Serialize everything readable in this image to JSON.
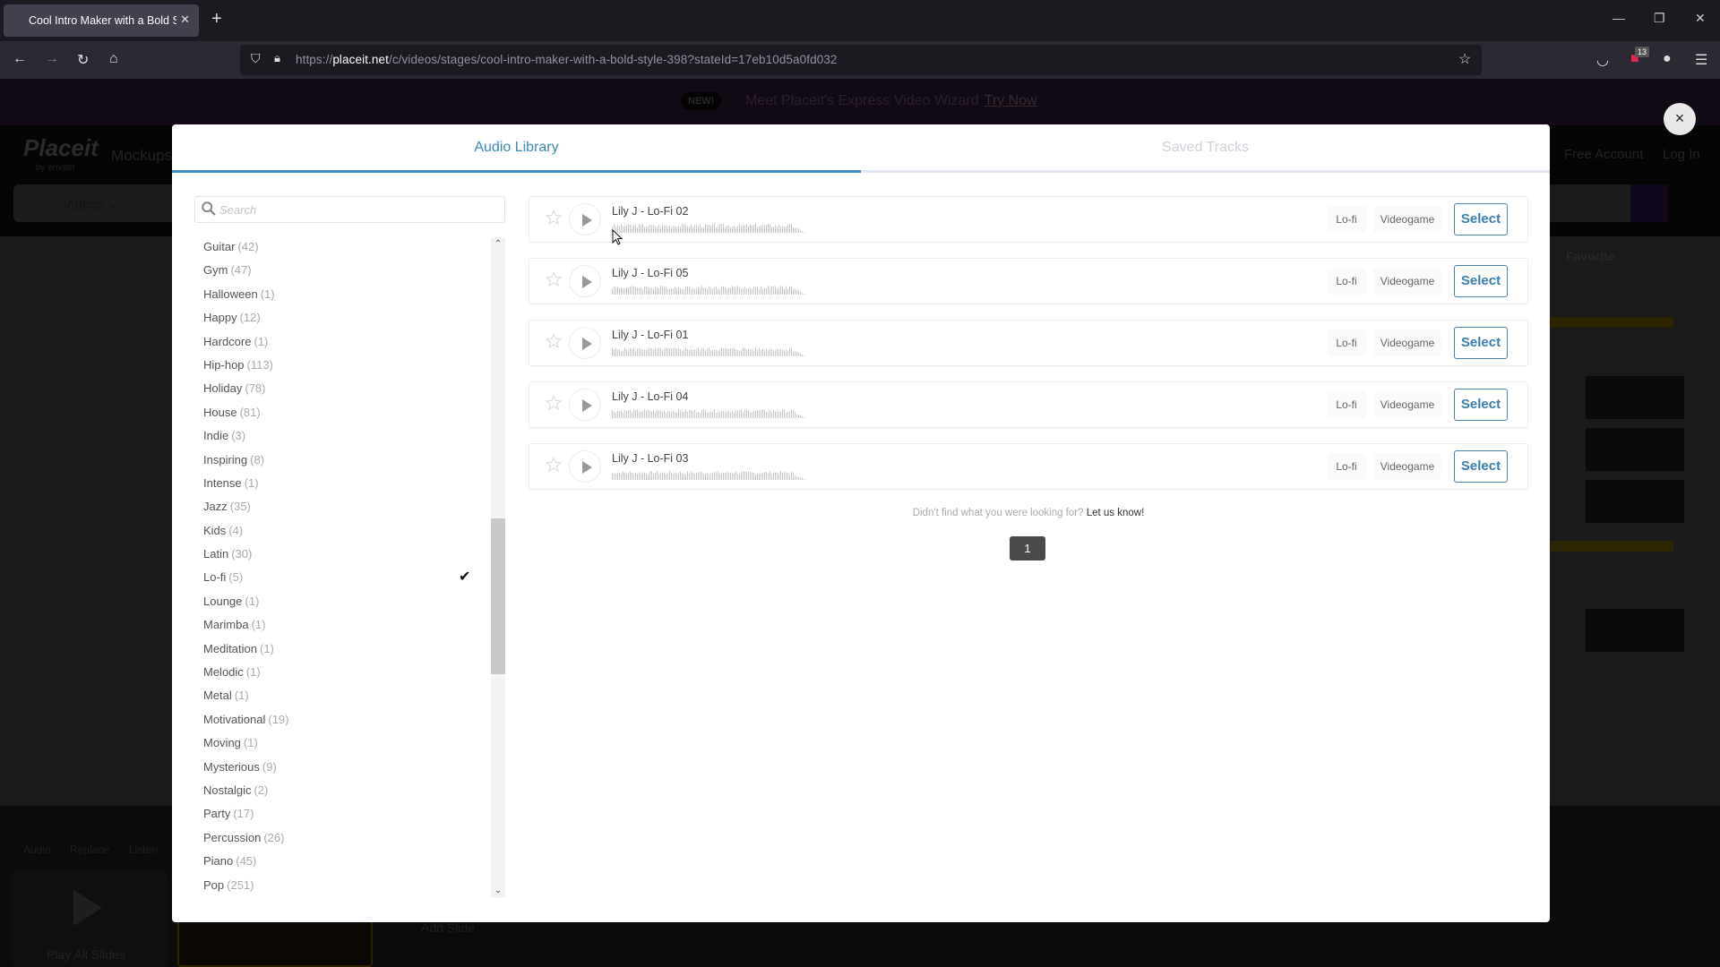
{
  "browser": {
    "tab_title": "Cool Intro Maker with a Bold Style",
    "url_prefix": "https://",
    "url_domain": "placeit.net",
    "url_path": "/c/videos/stages/cool-intro-maker-with-a-bold-style-398?stateId=17eb10d5a0fd032",
    "extension_badge": "13",
    "icons": [
      "back-icon",
      "forward-icon",
      "reload-icon",
      "home-icon",
      "shield-icon",
      "lock-icon",
      "bookmark-star-icon",
      "pocket-icon",
      "extension-icon",
      "account-icon",
      "menu-icon"
    ]
  },
  "background_page": {
    "banner": {
      "badge": "NEW!",
      "text": "Meet Placeit's Express Video Wizard",
      "link": "Try Now"
    },
    "logo": "Placeit",
    "logo_sub": "by envato",
    "nav_mockups": "Mockups",
    "nav_free_account": "Free Account",
    "nav_login": "Log In",
    "category_select": "Videos",
    "right_panel_title": "Favorite",
    "bottom_tools": [
      "Audio",
      "Replace",
      "Listen"
    ],
    "play_all": "Play All Slides",
    "add_slide": "Add Slide"
  },
  "modal": {
    "close_label": "×",
    "tabs": [
      {
        "label": "Audio Library",
        "active": true
      },
      {
        "label": "Saved Tracks",
        "active": false
      }
    ],
    "search": {
      "placeholder": "Search",
      "value": ""
    },
    "categories": [
      {
        "name": "Guitar",
        "count": "(42)"
      },
      {
        "name": "Gym",
        "count": "(47)"
      },
      {
        "name": "Halloween",
        "count": "(1)"
      },
      {
        "name": "Happy",
        "count": "(12)"
      },
      {
        "name": "Hardcore",
        "count": "(1)"
      },
      {
        "name": "Hip-hop",
        "count": "(113)"
      },
      {
        "name": "Holiday",
        "count": "(78)"
      },
      {
        "name": "House",
        "count": "(81)"
      },
      {
        "name": "Indie",
        "count": "(3)"
      },
      {
        "name": "Inspiring",
        "count": "(8)"
      },
      {
        "name": "Intense",
        "count": "(1)"
      },
      {
        "name": "Jazz",
        "count": "(35)"
      },
      {
        "name": "Kids",
        "count": "(4)"
      },
      {
        "name": "Latin",
        "count": "(30)"
      },
      {
        "name": "Lo-fi",
        "count": "(5)",
        "selected": true
      },
      {
        "name": "Lounge",
        "count": "(1)"
      },
      {
        "name": "Marimba",
        "count": "(1)"
      },
      {
        "name": "Meditation",
        "count": "(1)"
      },
      {
        "name": "Melodic",
        "count": "(1)"
      },
      {
        "name": "Metal",
        "count": "(1)"
      },
      {
        "name": "Motivational",
        "count": "(19)"
      },
      {
        "name": "Moving",
        "count": "(1)"
      },
      {
        "name": "Mysterious",
        "count": "(9)"
      },
      {
        "name": "Nostalgic",
        "count": "(2)"
      },
      {
        "name": "Party",
        "count": "(17)"
      },
      {
        "name": "Percussion",
        "count": "(26)"
      },
      {
        "name": "Piano",
        "count": "(45)"
      },
      {
        "name": "Pop",
        "count": "(251)"
      }
    ],
    "tracks": [
      {
        "title": "Lily J - Lo-Fi 02",
        "tags": [
          "Lo-fi",
          "Videogame"
        ],
        "select_label": "Select"
      },
      {
        "title": "Lily J - Lo-Fi 05",
        "tags": [
          "Lo-fi",
          "Videogame"
        ],
        "select_label": "Select"
      },
      {
        "title": "Lily J - Lo-Fi 01",
        "tags": [
          "Lo-fi",
          "Videogame"
        ],
        "select_label": "Select"
      },
      {
        "title": "Lily J - Lo-Fi 04",
        "tags": [
          "Lo-fi",
          "Videogame"
        ],
        "select_label": "Select"
      },
      {
        "title": "Lily J - Lo-Fi 03",
        "tags": [
          "Lo-fi",
          "Videogame"
        ],
        "select_label": "Select"
      }
    ],
    "not_found_text": "Didn't find what you were looking for?",
    "not_found_link": "Let us know!",
    "pagination": {
      "current_page": "1"
    },
    "colors": {
      "accent": "#3a8ab8",
      "select_border": "#4d7fa2",
      "page_button": "#4a4a4a"
    }
  }
}
